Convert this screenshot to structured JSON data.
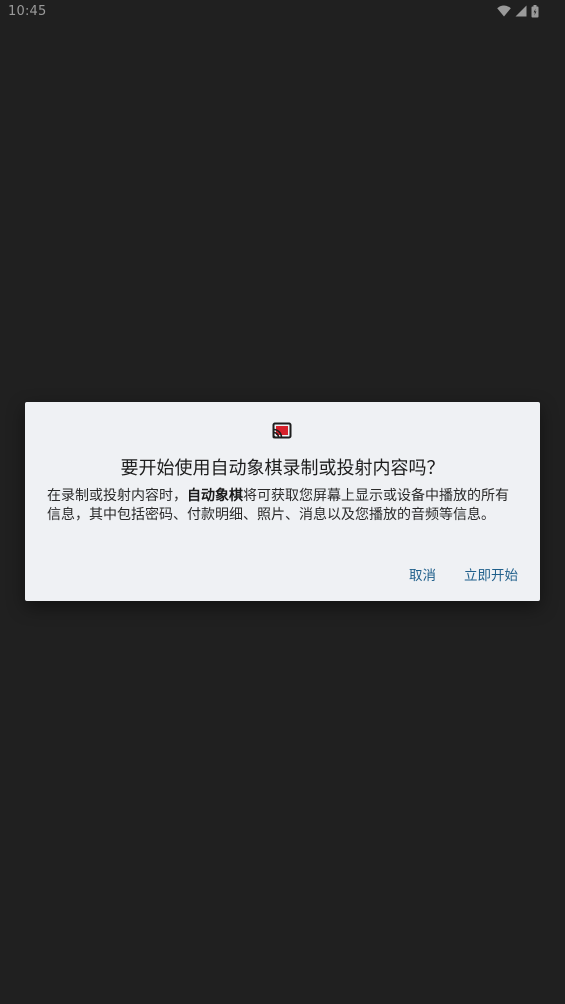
{
  "status_bar": {
    "time": "10:45",
    "icons": [
      "wifi-icon",
      "signal-icon",
      "battery-icon"
    ]
  },
  "dialog": {
    "icon": "cast-icon",
    "title": "要开始使用自动象棋录制或投射内容吗？",
    "message_prefix": "在录制或投射内容时，",
    "app_name": "自动象棋",
    "message_suffix": "将可获取您屏幕上显示或设备中播放的所有信息，其中包括密码、付款明细、照片、消息以及您播放的音频等信息。",
    "cancel_label": "取消",
    "start_label": "立即开始"
  },
  "colors": {
    "background": "#202020",
    "dialog_bg": "#eff1f4",
    "accent": "#1f5f8b",
    "cast_icon_red": "#d6202a"
  }
}
